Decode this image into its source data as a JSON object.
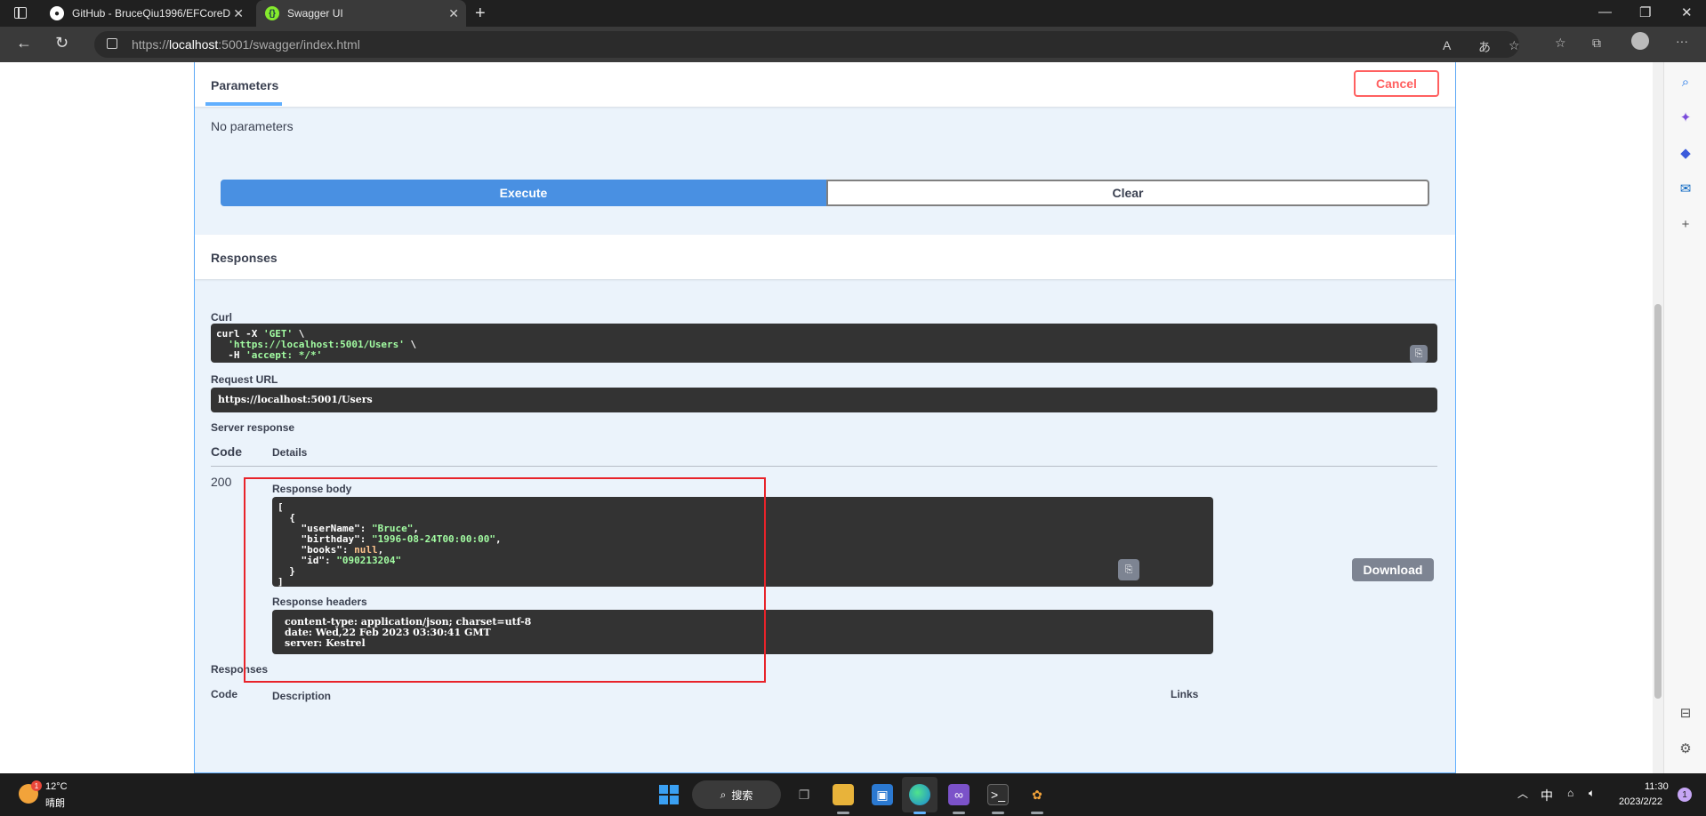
{
  "browser": {
    "tabs": [
      {
        "title": "GitHub - BruceQiu1996/EFCoreD"
      },
      {
        "title": "Swagger UI"
      }
    ],
    "url_scheme": "https://",
    "url_host": "localhost",
    "url_rest": ":5001/swagger/index.html"
  },
  "parameters": {
    "title": "Parameters",
    "cancel_label": "Cancel",
    "empty_text": "No parameters",
    "execute_label": "Execute",
    "clear_label": "Clear"
  },
  "responses": {
    "title": "Responses",
    "curl_label": "Curl",
    "request_url_label": "Request URL",
    "request_url": "https://localhost:5001/Users",
    "server_response_label": "Server response",
    "code_header": "Code",
    "details_header": "Details",
    "status_code": "200",
    "response_body_label": "Response body",
    "download_label": "Download",
    "response_headers_label": "Response headers",
    "headers": {
      "line1": "content-type: application/json; charset=utf-8",
      "line2": "date: Wed,22 Feb 2023 03:30:41 GMT",
      "line3": "server: Kestrel"
    },
    "bottom_title": "Responses",
    "bottom_code_header": "Code",
    "bottom_desc_header": "Description",
    "bottom_links_header": "Links"
  },
  "curl": {
    "line1_cmd": "curl -X ",
    "line1_method": "'GET'",
    "line1_tail": " \\",
    "line2_url": "'https://localhost:5001/Users'",
    "line2_tail": " \\",
    "line3_cmd": "  -H ",
    "line3_header": "'accept: */*'"
  },
  "body": {
    "open": "[",
    "obj_open": "  {",
    "k1": "    \"userName\": ",
    "v1": "\"Bruce\"",
    "k2": "    \"birthday\": ",
    "v2": "\"1996-08-24T00:00:00\"",
    "k3": "    \"books\": ",
    "v3": "null",
    "k4": "    \"id\": ",
    "v4": "\"090213204\"",
    "obj_close": "  }",
    "close": "]"
  },
  "taskbar": {
    "weather_temp": "12°C",
    "weather_cond": "晴朗",
    "weather_badge": "1",
    "search_label": "搜索",
    "ime": "中",
    "time": "11:30",
    "date": "2023/2/22",
    "notification_count": "1"
  },
  "colors": {
    "accent": "#61affe",
    "execute": "#4990e2",
    "cancel": "#ff6060",
    "highlight": "#e8232a"
  }
}
